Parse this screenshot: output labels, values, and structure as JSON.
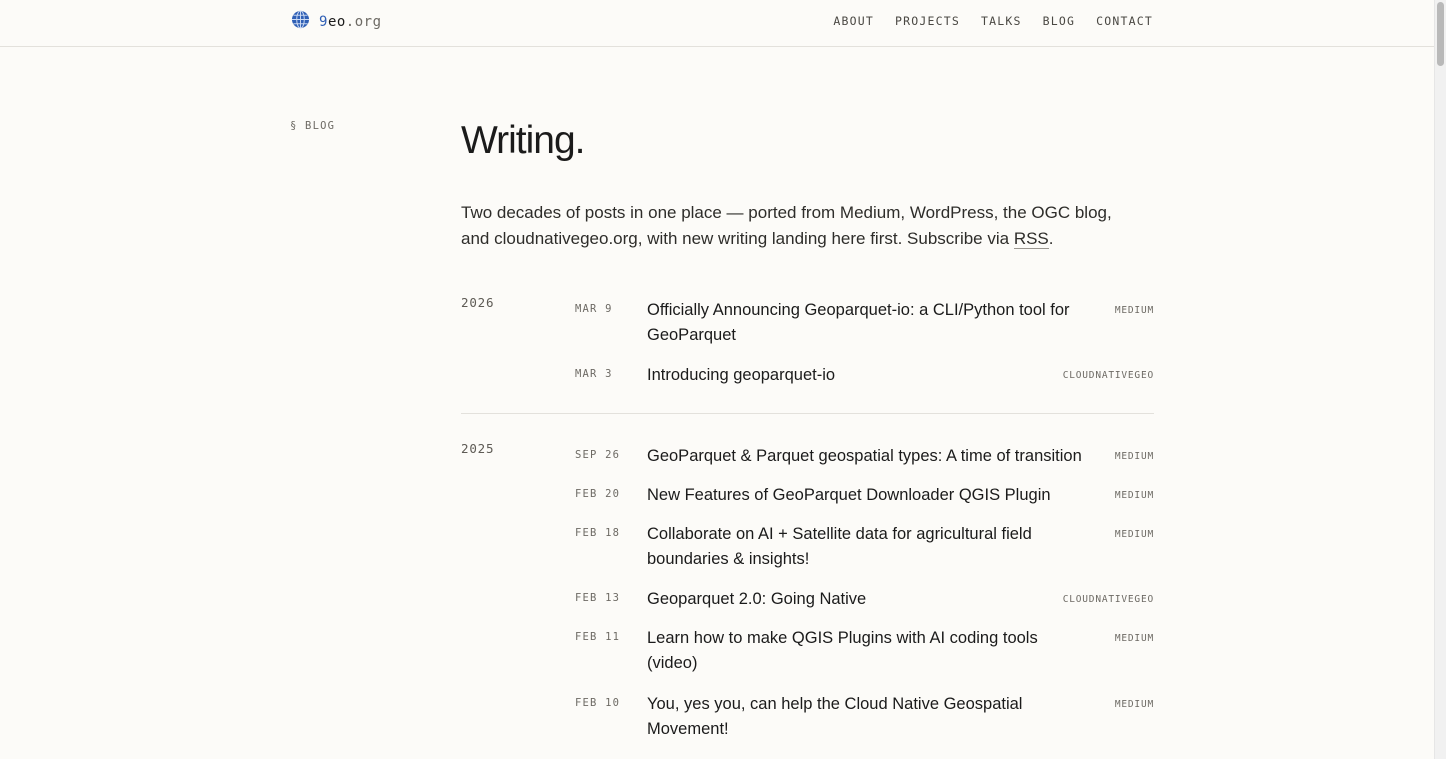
{
  "brand": {
    "nine": "9",
    "eo": "eo",
    "tld": ".org",
    "icon": "globe-icon",
    "accent": "#2f5fb5"
  },
  "nav": [
    "ABOUT",
    "PROJECTS",
    "TALKS",
    "BLOG",
    "CONTACT"
  ],
  "section_label": "§ BLOG",
  "title": "Writing.",
  "intro": {
    "text": "Two decades of posts in one place — ported from Medium, WordPress, the OGC blog, and cloudnativegeo.org, with new writing landing here first. Subscribe via ",
    "rss": "RSS",
    "end": "."
  },
  "groups": [
    {
      "year": "2026",
      "posts": [
        {
          "date": "MAR 9",
          "title": "Officially Announcing Geoparquet-io: a CLI/Python tool for GeoParquet",
          "source": "MEDIUM"
        },
        {
          "date": "MAR 3",
          "title": "Introducing geoparquet-io",
          "source": "CLOUDNATIVEGEO"
        }
      ]
    },
    {
      "year": "2025",
      "posts": [
        {
          "date": "SEP 26",
          "title": "GeoParquet & Parquet geospatial types: A time of transition",
          "source": "MEDIUM"
        },
        {
          "date": "FEB 20",
          "title": "New Features of GeoParquet Downloader QGIS Plugin",
          "source": "MEDIUM"
        },
        {
          "date": "FEB 18",
          "title": "Collaborate on AI + Satellite data for agricultural field boundaries & insights!",
          "source": "MEDIUM"
        },
        {
          "date": "FEB 13",
          "title": "Geoparquet 2.0: Going Native",
          "source": "CLOUDNATIVEGEO"
        },
        {
          "date": "FEB 11",
          "title": "Learn how to make QGIS Plugins with AI coding tools (video)",
          "source": "MEDIUM"
        },
        {
          "date": "FEB 10",
          "title": "You, yes you, can help the Cloud Native Geospatial Movement!",
          "source": "MEDIUM"
        }
      ]
    }
  ]
}
